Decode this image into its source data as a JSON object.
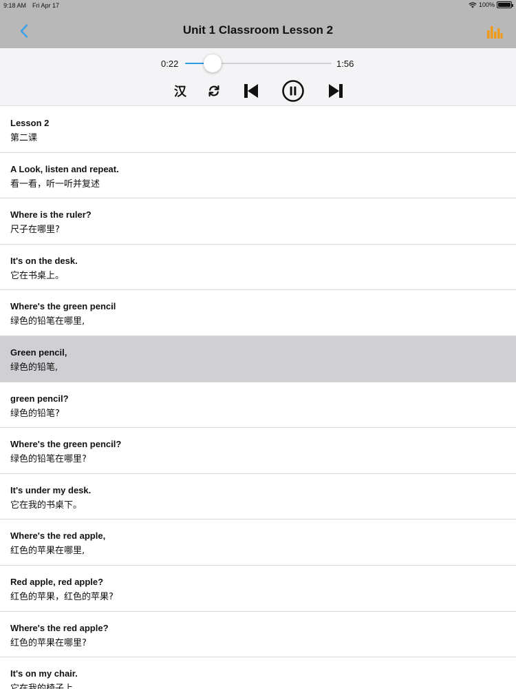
{
  "status": {
    "time": "9:18 AM",
    "date": "Fri Apr 17",
    "battery_label": "100%",
    "wifi_icon": "wifi-icon",
    "battery_icon": "battery-icon"
  },
  "nav": {
    "title": "Unit 1 Classroom Lesson 2",
    "back_icon": "chevron-left-icon",
    "chart_icon": "bar-chart-icon",
    "back_color": "#3aa0e8",
    "chart_color": "#f09a1a"
  },
  "player": {
    "current_time": "0:22",
    "total_time": "1:56",
    "progress": 0.19,
    "accent": "#2e9be6",
    "han_label": "汉",
    "icons": [
      "repeat-icon",
      "skip-previous-icon",
      "pause-icon",
      "skip-next-icon"
    ]
  },
  "lines": [
    {
      "en": "Lesson 2",
      "zh": "第二课"
    },
    {
      "en": "A Look, listen and repeat.",
      "zh": "看一看，听一听并复述"
    },
    {
      "en": "Where is the ruler?",
      "zh": "尺子在哪里?"
    },
    {
      "en": "It's on the desk.",
      "zh": "它在书桌上。"
    },
    {
      "en": "Where's the green pencil",
      "zh": "绿色的铅笔在哪里,"
    },
    {
      "en": "Green pencil,",
      "zh": "绿色的铅笔,",
      "selected": true
    },
    {
      "en": "green pencil?",
      "zh": "绿色的铅笔?"
    },
    {
      "en": "Where's the green pencil?",
      "zh": "绿色的铅笔在哪里?"
    },
    {
      "en": "It's under my desk.",
      "zh": "它在我的书桌下。"
    },
    {
      "en": "Where's the red apple,",
      "zh": "红色的苹果在哪里,"
    },
    {
      "en": "Red apple, red apple?",
      "zh": "红色的苹果，红色的苹果?"
    },
    {
      "en": "Where's the red apple?",
      "zh": "红色的苹果在哪里?"
    },
    {
      "en": "It's on my chair.",
      "zh": "它在我的椅子上。"
    }
  ]
}
